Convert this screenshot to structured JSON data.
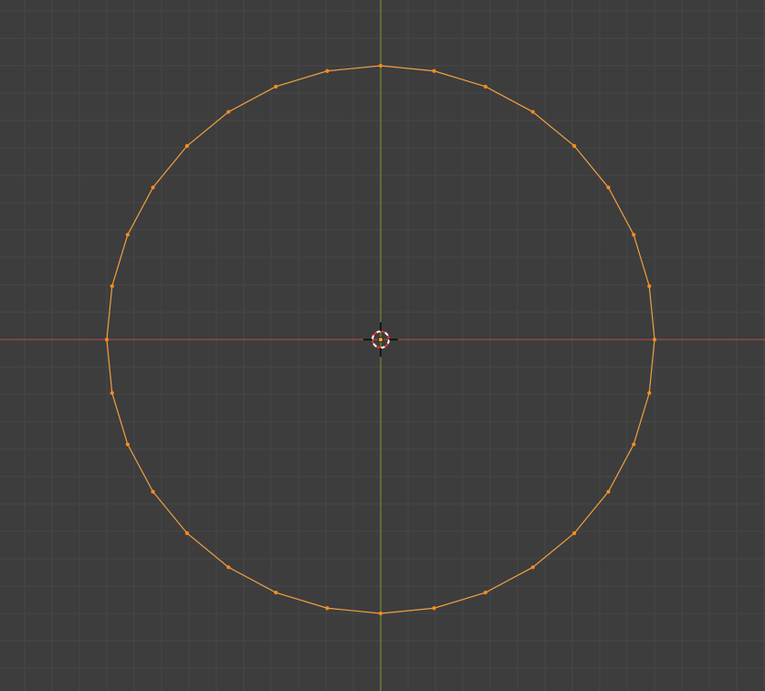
{
  "viewport": {
    "view": "top-orthographic",
    "mode": "edit-mode",
    "selection": "all-vertices-selected",
    "background_color": "#3d3d3d",
    "grid": {
      "visible": true,
      "minor_color": "#474747",
      "major_color": "#4d4d4d"
    },
    "axes": {
      "x_axis_color": "#b84c4c",
      "y_axis_color": "#7a9a2a"
    },
    "mesh": {
      "type": "circle",
      "vertex_count": 32,
      "edge_color": "#f0a040",
      "vertex_color": "#ff8a1a",
      "selected": true
    },
    "origin": {
      "icon": "object-origin-icon",
      "color": "#ffa033"
    },
    "cursor_3d": {
      "icon": "3d-cursor-icon",
      "ring_colors": [
        "#ffffff",
        "#e03030"
      ],
      "crosshair_color": "#000000"
    }
  }
}
